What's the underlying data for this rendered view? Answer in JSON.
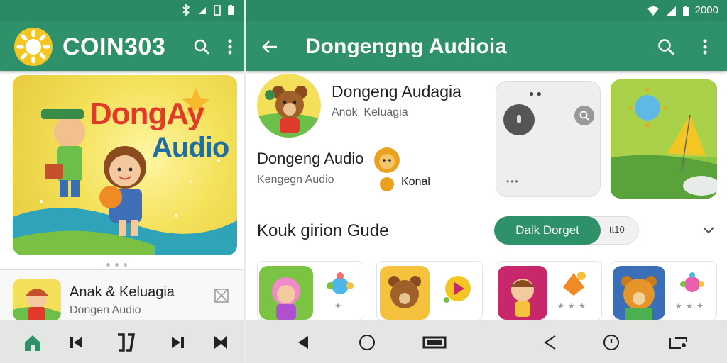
{
  "left": {
    "status": {
      "icons": [
        "bluetooth-icon",
        "signal-icon",
        "vibrate-icon",
        "battery-icon"
      ]
    },
    "appbar": {
      "title": "COIN303",
      "icons": [
        "search-icon",
        "more-vert-icon"
      ]
    },
    "cover": {
      "title_line1": "DongAy",
      "title_line2": "Audio"
    },
    "now_playing": {
      "title": "Anak & Keluagia",
      "subtitle": "Dongen Audio",
      "action_icon": "close-icon"
    },
    "nav": {
      "items": [
        "home-icon",
        "skip-previous-icon",
        "pause-icon",
        "skip-next-icon",
        "bookmark-icon"
      ]
    }
  },
  "right": {
    "status": {
      "time": "2000"
    },
    "appbar": {
      "title": "Dongengng Audioia",
      "icons": [
        "back-arrow-icon",
        "search-icon",
        "more-vert-icon"
      ]
    },
    "featured": {
      "title": "Dongeng Audagia",
      "subtitle": "Anok  Keluagia",
      "title2": "Dongeng Audio",
      "subtitle2": "Kengegn Audio",
      "badge": "Konal"
    },
    "section": {
      "title": "Kouk girion Gude",
      "button": "Dalk Dorget",
      "pill": "tt10"
    },
    "nav": {
      "items": [
        "back-triangle-icon",
        "home-circle-icon",
        "recents-icon",
        "back-outline-icon",
        "info-circle-icon",
        "cast-icon"
      ]
    }
  },
  "colors": {
    "primary": "#2e9169",
    "primary_dark": "#2a8a64",
    "accent": "#f4e15a"
  }
}
